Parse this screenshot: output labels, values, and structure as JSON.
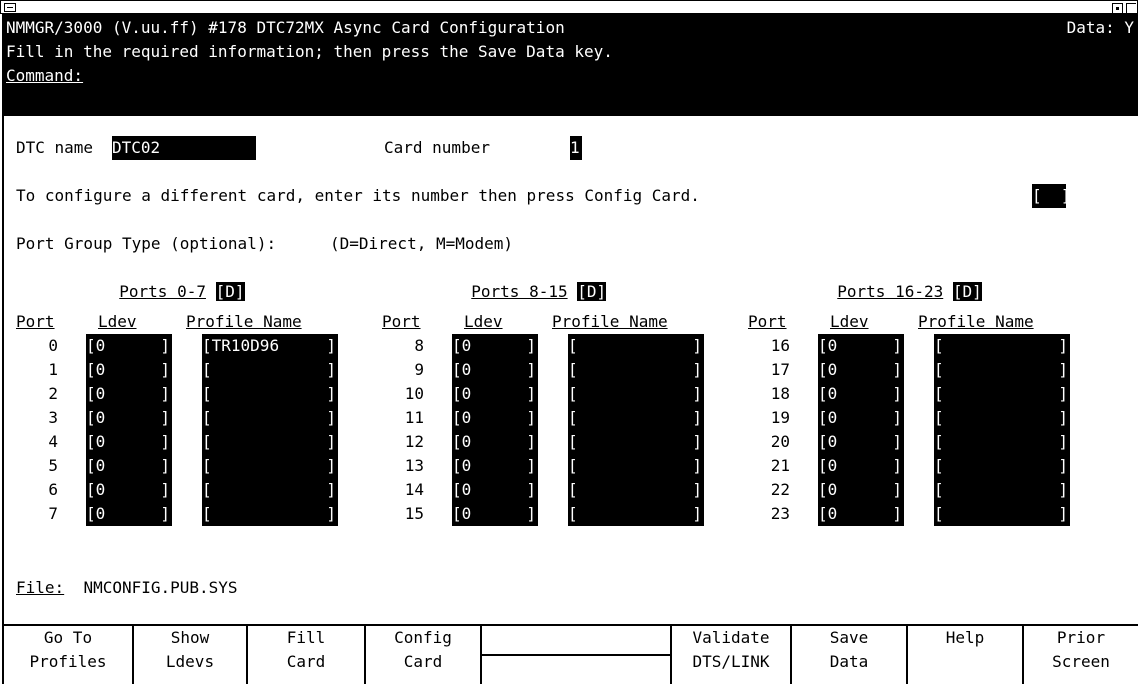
{
  "header": {
    "line1": "NMMGR/3000 (V.uu.ff) #178 DTC72MX Async Card Configuration",
    "data_indicator": "Data: Y",
    "line2": "Fill in the required information; then press the Save Data key.",
    "command_label": "Command:"
  },
  "dtc": {
    "label": "DTC name",
    "value": "DTC02",
    "card_label": "Card number",
    "card_value": "1"
  },
  "config_line": {
    "text": "To configure a different card, enter its number then press Config Card.",
    "field_value": ""
  },
  "port_group": {
    "label": "Port Group Type (optional):",
    "legend": "(D=Direct, M=Modem)",
    "groups": [
      {
        "label": "Ports 0-7",
        "value": "D"
      },
      {
        "label": "Ports 8-15",
        "value": "D"
      },
      {
        "label": "Ports 16-23",
        "value": "D"
      }
    ]
  },
  "table": {
    "headers": {
      "port": "Port",
      "ldev": "Ldev",
      "profile": "Profile Name"
    },
    "columns": [
      {
        "rows": [
          {
            "port": "0",
            "ldev": "0",
            "profile": "TR10D96"
          },
          {
            "port": "1",
            "ldev": "0",
            "profile": ""
          },
          {
            "port": "2",
            "ldev": "0",
            "profile": ""
          },
          {
            "port": "3",
            "ldev": "0",
            "profile": ""
          },
          {
            "port": "4",
            "ldev": "0",
            "profile": ""
          },
          {
            "port": "5",
            "ldev": "0",
            "profile": ""
          },
          {
            "port": "6",
            "ldev": "0",
            "profile": ""
          },
          {
            "port": "7",
            "ldev": "0",
            "profile": ""
          }
        ]
      },
      {
        "rows": [
          {
            "port": "8",
            "ldev": "0",
            "profile": ""
          },
          {
            "port": "9",
            "ldev": "0",
            "profile": ""
          },
          {
            "port": "10",
            "ldev": "0",
            "profile": ""
          },
          {
            "port": "11",
            "ldev": "0",
            "profile": ""
          },
          {
            "port": "12",
            "ldev": "0",
            "profile": ""
          },
          {
            "port": "13",
            "ldev": "0",
            "profile": ""
          },
          {
            "port": "14",
            "ldev": "0",
            "profile": ""
          },
          {
            "port": "15",
            "ldev": "0",
            "profile": ""
          }
        ]
      },
      {
        "rows": [
          {
            "port": "16",
            "ldev": "0",
            "profile": ""
          },
          {
            "port": "17",
            "ldev": "0",
            "profile": ""
          },
          {
            "port": "18",
            "ldev": "0",
            "profile": ""
          },
          {
            "port": "19",
            "ldev": "0",
            "profile": ""
          },
          {
            "port": "20",
            "ldev": "0",
            "profile": ""
          },
          {
            "port": "21",
            "ldev": "0",
            "profile": ""
          },
          {
            "port": "22",
            "ldev": "0",
            "profile": ""
          },
          {
            "port": "23",
            "ldev": "0",
            "profile": ""
          }
        ]
      }
    ]
  },
  "file": {
    "label": "File:",
    "value": "NMCONFIG.PUB.SYS"
  },
  "softkeys": [
    {
      "line1": "Go To",
      "line2": "Profiles"
    },
    {
      "line1": "Show",
      "line2": "Ldevs"
    },
    {
      "line1": "Fill",
      "line2": "Card"
    },
    {
      "line1": "Config",
      "line2": "Card"
    },
    {
      "line1": "",
      "line2": ""
    },
    {
      "line1": "Validate",
      "line2": "DTS/LINK"
    },
    {
      "line1": "Save",
      "line2": "Data"
    },
    {
      "line1": "Help",
      "line2": ""
    },
    {
      "line1": "Prior",
      "line2": "Screen"
    }
  ]
}
